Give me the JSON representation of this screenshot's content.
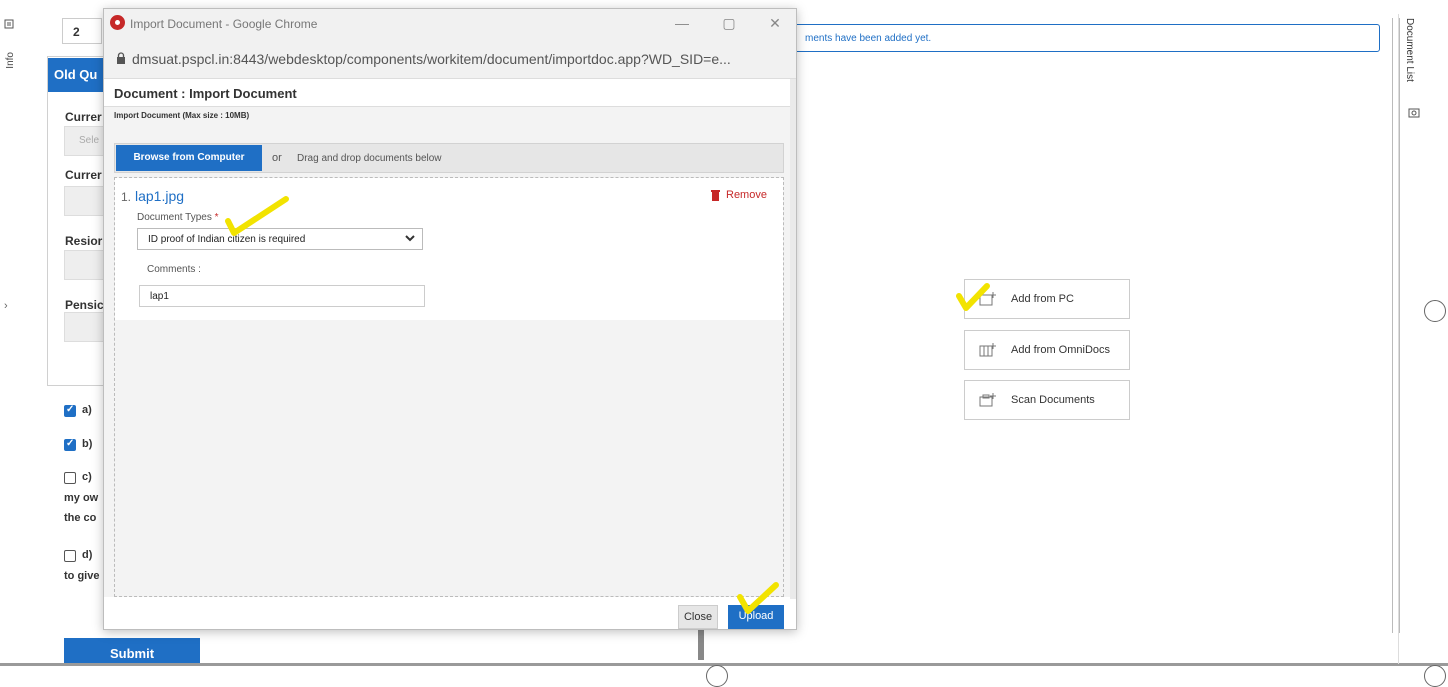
{
  "background": {
    "info_tab_label": "Info",
    "step_number": "2",
    "section_header": "Old Qu",
    "fields": [
      "Currer",
      "Currer",
      "Resior",
      "Pensic"
    ],
    "select_placeholder": "Sele",
    "checkboxes": [
      {
        "label": "a)",
        "checked": true
      },
      {
        "label": "b)",
        "checked": true
      },
      {
        "label": "c)",
        "checked": false,
        "continuation": [
          "my ow",
          "the co"
        ]
      },
      {
        "label": "d)",
        "checked": false,
        "continuation": [
          "to give"
        ]
      }
    ],
    "submit_label": "Submit",
    "notice_text": "ments have been added yet.",
    "document_list_label": "Document List",
    "add_buttons": [
      {
        "label": "Add from PC",
        "icon": "add-from-pc-icon"
      },
      {
        "label": "Add from OmniDocs",
        "icon": "add-from-omnidocs-icon"
      },
      {
        "label": "Scan Documents",
        "icon": "scan-documents-icon"
      }
    ]
  },
  "popup": {
    "window_title": "Import Document - Google Chrome",
    "url": "dmsuat.pspcl.in:8443/webdesktop/components/workitem/document/importdoc.app?WD_SID=e...",
    "header": "Document : Import Document",
    "import_label": "Import Document (Max size : 10MB)",
    "browse_button": "Browse from Computer",
    "or_text": "or",
    "drag_text": "Drag and drop documents below",
    "file": {
      "index": "1.",
      "name": "lap1.jpg",
      "remove_label": "Remove",
      "doc_types_label": "Document Types",
      "required_mark": "*",
      "doc_type_value": "ID proof of Indian citizen is required",
      "comments_label": "Comments :",
      "comments_value": "lap1"
    },
    "close_button": "Close",
    "upload_button": "Upload"
  },
  "colors": {
    "accent": "#1f6fc5",
    "danger": "#c62828",
    "annotation": "#f2e300"
  }
}
